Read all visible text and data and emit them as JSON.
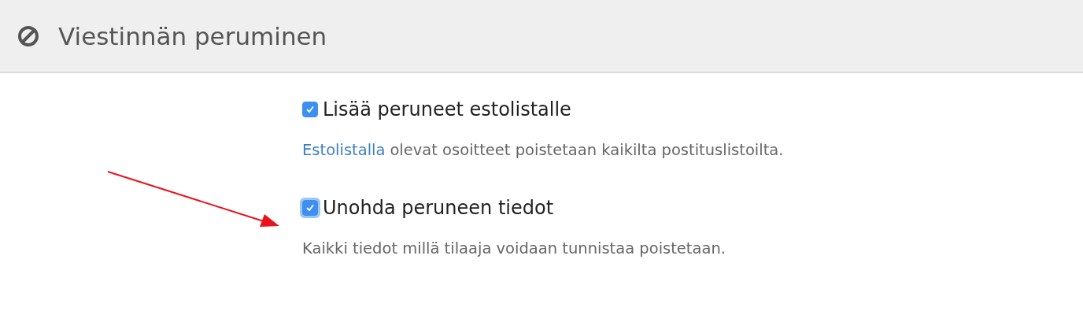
{
  "header": {
    "title": "Viestinnän peruminen"
  },
  "options": [
    {
      "label": "Lisää peruneet estolistalle",
      "checked": true,
      "focused": false,
      "description": {
        "link": "Estolistalla",
        "text": "olevat osoitteet poistetaan kaikilta postituslistoilta."
      }
    },
    {
      "label": "Unohda peruneen tiedot",
      "checked": true,
      "focused": true,
      "description": {
        "text": "Kaikki tiedot millä tilaaja voidaan tunnistaa poistetaan."
      }
    }
  ],
  "annotation": {
    "kind": "arrow"
  }
}
